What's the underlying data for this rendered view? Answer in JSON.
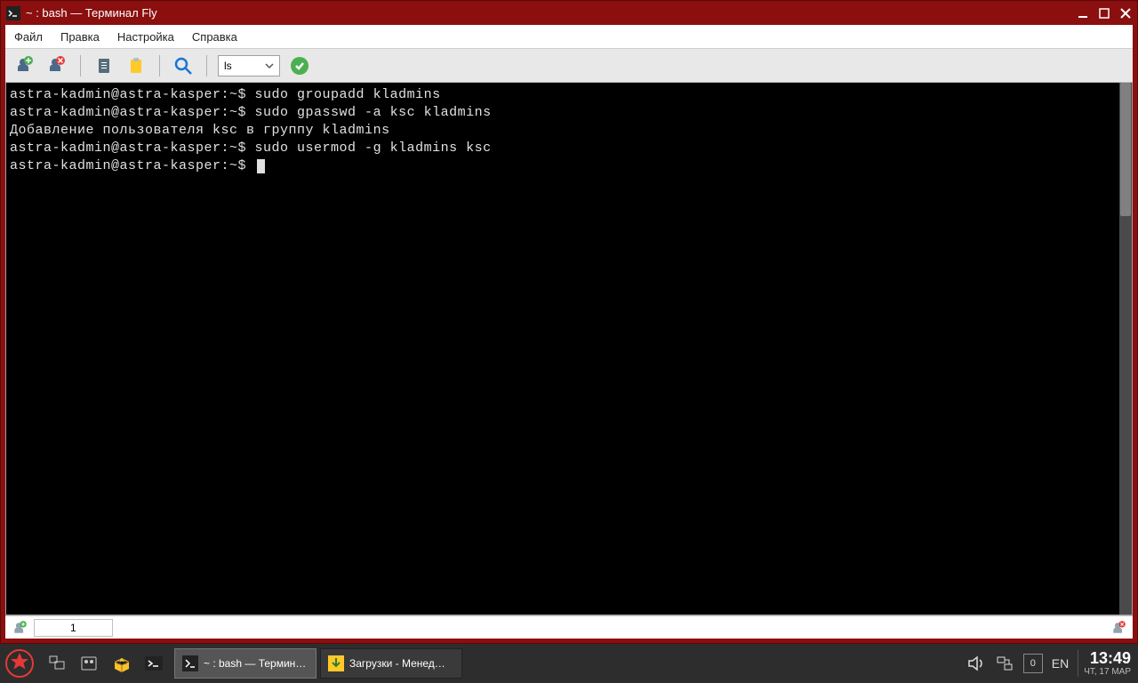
{
  "window": {
    "title": "~ : bash — Терминал Fly"
  },
  "menubar": {
    "file": "Файл",
    "edit": "Правка",
    "settings": "Настройка",
    "help": "Справка"
  },
  "toolbar": {
    "combo_value": "ls"
  },
  "terminal": {
    "lines": [
      {
        "prompt": "astra-kadmin@astra-kasper:~$ ",
        "cmd": "sudo groupadd kladmins"
      },
      {
        "prompt": "astra-kadmin@astra-kasper:~$ ",
        "cmd": "sudo gpasswd -a ksc kladmins"
      },
      {
        "prompt": "",
        "cmd": "Добавление пользователя ksc в группу kladmins"
      },
      {
        "prompt": "astra-kadmin@astra-kasper:~$ ",
        "cmd": "sudo usermod -g kladmins ksc"
      },
      {
        "prompt": "astra-kadmin@astra-kasper:~$ ",
        "cmd": ""
      }
    ]
  },
  "statusbar": {
    "tab_number": "1"
  },
  "taskbar": {
    "tasks": [
      {
        "label": "~ : bash — Термин…",
        "active": true
      },
      {
        "label": "Загрузки - Менед…",
        "active": false
      }
    ],
    "tray": {
      "kbd_badge": "0",
      "lang": "EN",
      "time": "13:49",
      "date": "ЧТ, 17 МАР"
    }
  }
}
